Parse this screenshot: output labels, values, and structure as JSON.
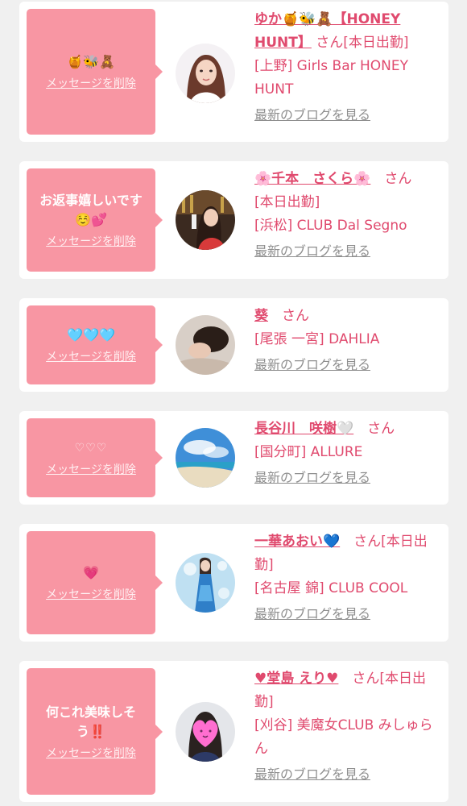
{
  "delete_label": "メッセージを削除",
  "san_label": "さん",
  "blog_label": "最新のブログを見る",
  "colors": {
    "bubble": "#f896a3",
    "accent": "#e04a6e",
    "link_gray": "#8f8f8f",
    "background": "#f0f0f0"
  },
  "cards": [
    {
      "message": "🍯🐝🧸",
      "name": "ゆか🍯🐝🧸【HONEY HUNT】",
      "after_san": "[本日出勤]",
      "store": "[上野] Girls Bar HONEY HUNT",
      "avatar": "woman-portrait-white"
    },
    {
      "message": "お返事嬉しいです☺️💕",
      "name": "🌸千本　さくら🌸",
      "after_san": "",
      "store_status": "[本日出勤]",
      "store": "[浜松] CLUB Dal Segno",
      "avatar": "woman-bar-dark"
    },
    {
      "message": "🩵🩵🩵",
      "name": "葵",
      "after_san": "",
      "store": "[尾張 一宮] DAHLIA",
      "avatar": "woman-lying"
    },
    {
      "message": "♡♡♡",
      "name": "長谷川　咲樹🤍",
      "after_san": "",
      "store": "[国分町] ALLURE",
      "avatar": "beach-sky"
    },
    {
      "message": "💗",
      "name": "一華あおい💙",
      "after_san": "[本日出勤]",
      "store": "[名古屋 錦] CLUB COOL",
      "avatar": "woman-blue-dress"
    },
    {
      "message": "何これ美味しそう‼️",
      "name": "♥堂島 えり♥",
      "after_san": "[本日出勤]",
      "store": "[刈谷] 美魔女CLUB みしゅらん",
      "avatar": "heart-face"
    }
  ]
}
